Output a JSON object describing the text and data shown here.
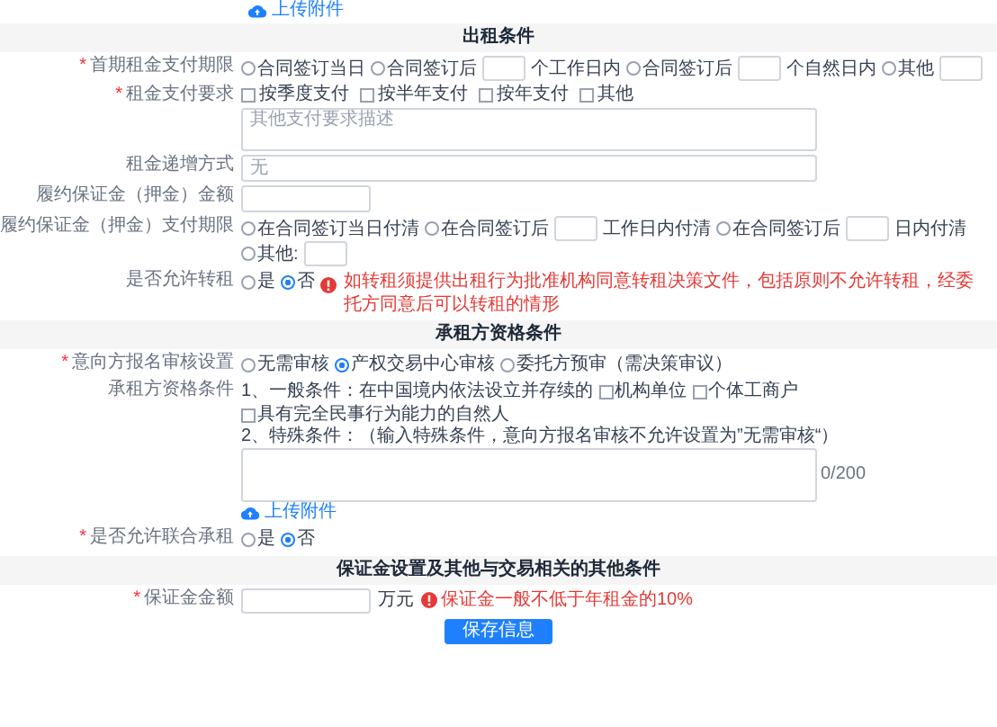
{
  "top_upload": {
    "label": "上传附件"
  },
  "sections": [
    {
      "title": "出租条件",
      "fields": [
        {
          "kind": "radio",
          "label": "首期租金支付期限",
          "required_mark": "*",
          "options": [
            {
              "label": "合同签订当日",
              "selected": false,
              "has_input": false
            },
            {
              "label": "合同签订后",
              "selected": false,
              "has_input": true,
              "suffix": "个工作日内"
            },
            {
              "label": "合同签订后",
              "selected": false,
              "has_input": true,
              "suffix": "个自然日内"
            },
            {
              "label": "其他",
              "selected": false,
              "has_input": true
            }
          ]
        },
        {
          "kind": "checks_textarea",
          "label": "租金支付要求",
          "required_mark": "*",
          "options": [
            {
              "label": "按季度支付",
              "checked": false
            },
            {
              "label": "按半年支付",
              "checked": false
            },
            {
              "label": "按年支付",
              "checked": false
            },
            {
              "label": "其他",
              "checked": false
            }
          ],
          "placeholder": "其他支付要求描述"
        },
        {
          "kind": "wide_input",
          "label": "租金递增方式",
          "placeholder": "无"
        },
        {
          "kind": "short_input",
          "label": "履约保证金（押金）金额"
        },
        {
          "kind": "radio",
          "label": "履约保证金（押金）支付期限",
          "options": [
            {
              "label": "在合同签订当日付清",
              "selected": false,
              "has_input": false
            },
            {
              "label": "在合同签订后",
              "selected": false,
              "has_input": true,
              "suffix": "工作日内付清"
            },
            {
              "label": "在合同签订后",
              "selected": false,
              "has_input": true,
              "suffix": "日内付清"
            },
            {
              "label": "其他:",
              "selected": false,
              "has_input": true
            }
          ]
        },
        {
          "kind": "radio",
          "label": "是否允许转租",
          "options": [
            {
              "label": "是",
              "selected": false,
              "has_input": false
            },
            {
              "label": "否",
              "selected": true,
              "has_input": false
            }
          ],
          "notice": "如转租须提供出租行为批准机构同意转租决策文件，包括原则不允许转租，经委托方同意后可以转租的情形"
        }
      ]
    },
    {
      "title": "承租方资格条件",
      "fields": [
        {
          "kind": "radio",
          "label": "意向方报名审核设置",
          "required_mark": "*",
          "options": [
            {
              "label": "无需审核",
              "selected": false,
              "has_input": false
            },
            {
              "label": "产权交易中心审核",
              "selected": true,
              "has_input": false
            },
            {
              "label": "委托方预审（需决策审议）",
              "selected": false,
              "has_input": false
            }
          ]
        },
        {
          "kind": "qualification",
          "label": "承租方资格条件",
          "general": "1、一般条件：在中国境内依法设立并存续的",
          "options": [
            {
              "label": "机构单位",
              "checked": false
            },
            {
              "label": "个体工商户",
              "checked": false
            },
            {
              "label": "具有完全民事行为能力的自然人",
              "checked": false
            }
          ],
          "special": "2、特殊条件：（输入特殊条件，意向方报名审核不允许设置为”无需审核“）",
          "counter": "0/200",
          "upload": "上传附件"
        },
        {
          "kind": "radio",
          "label": "是否允许联合承租",
          "required_mark": "*",
          "options": [
            {
              "label": "是",
              "selected": false,
              "has_input": false
            },
            {
              "label": "否",
              "selected": true,
              "has_input": false
            }
          ]
        }
      ]
    },
    {
      "title": "保证金设置及其他与交易相关的其他条件",
      "fields": [
        {
          "kind": "amount",
          "label": "保证金金额",
          "required_mark": "*",
          "unit": "万元",
          "notice": "保证金一般不低于年租金的10%"
        }
      ]
    }
  ],
  "save_button": "保存信息"
}
